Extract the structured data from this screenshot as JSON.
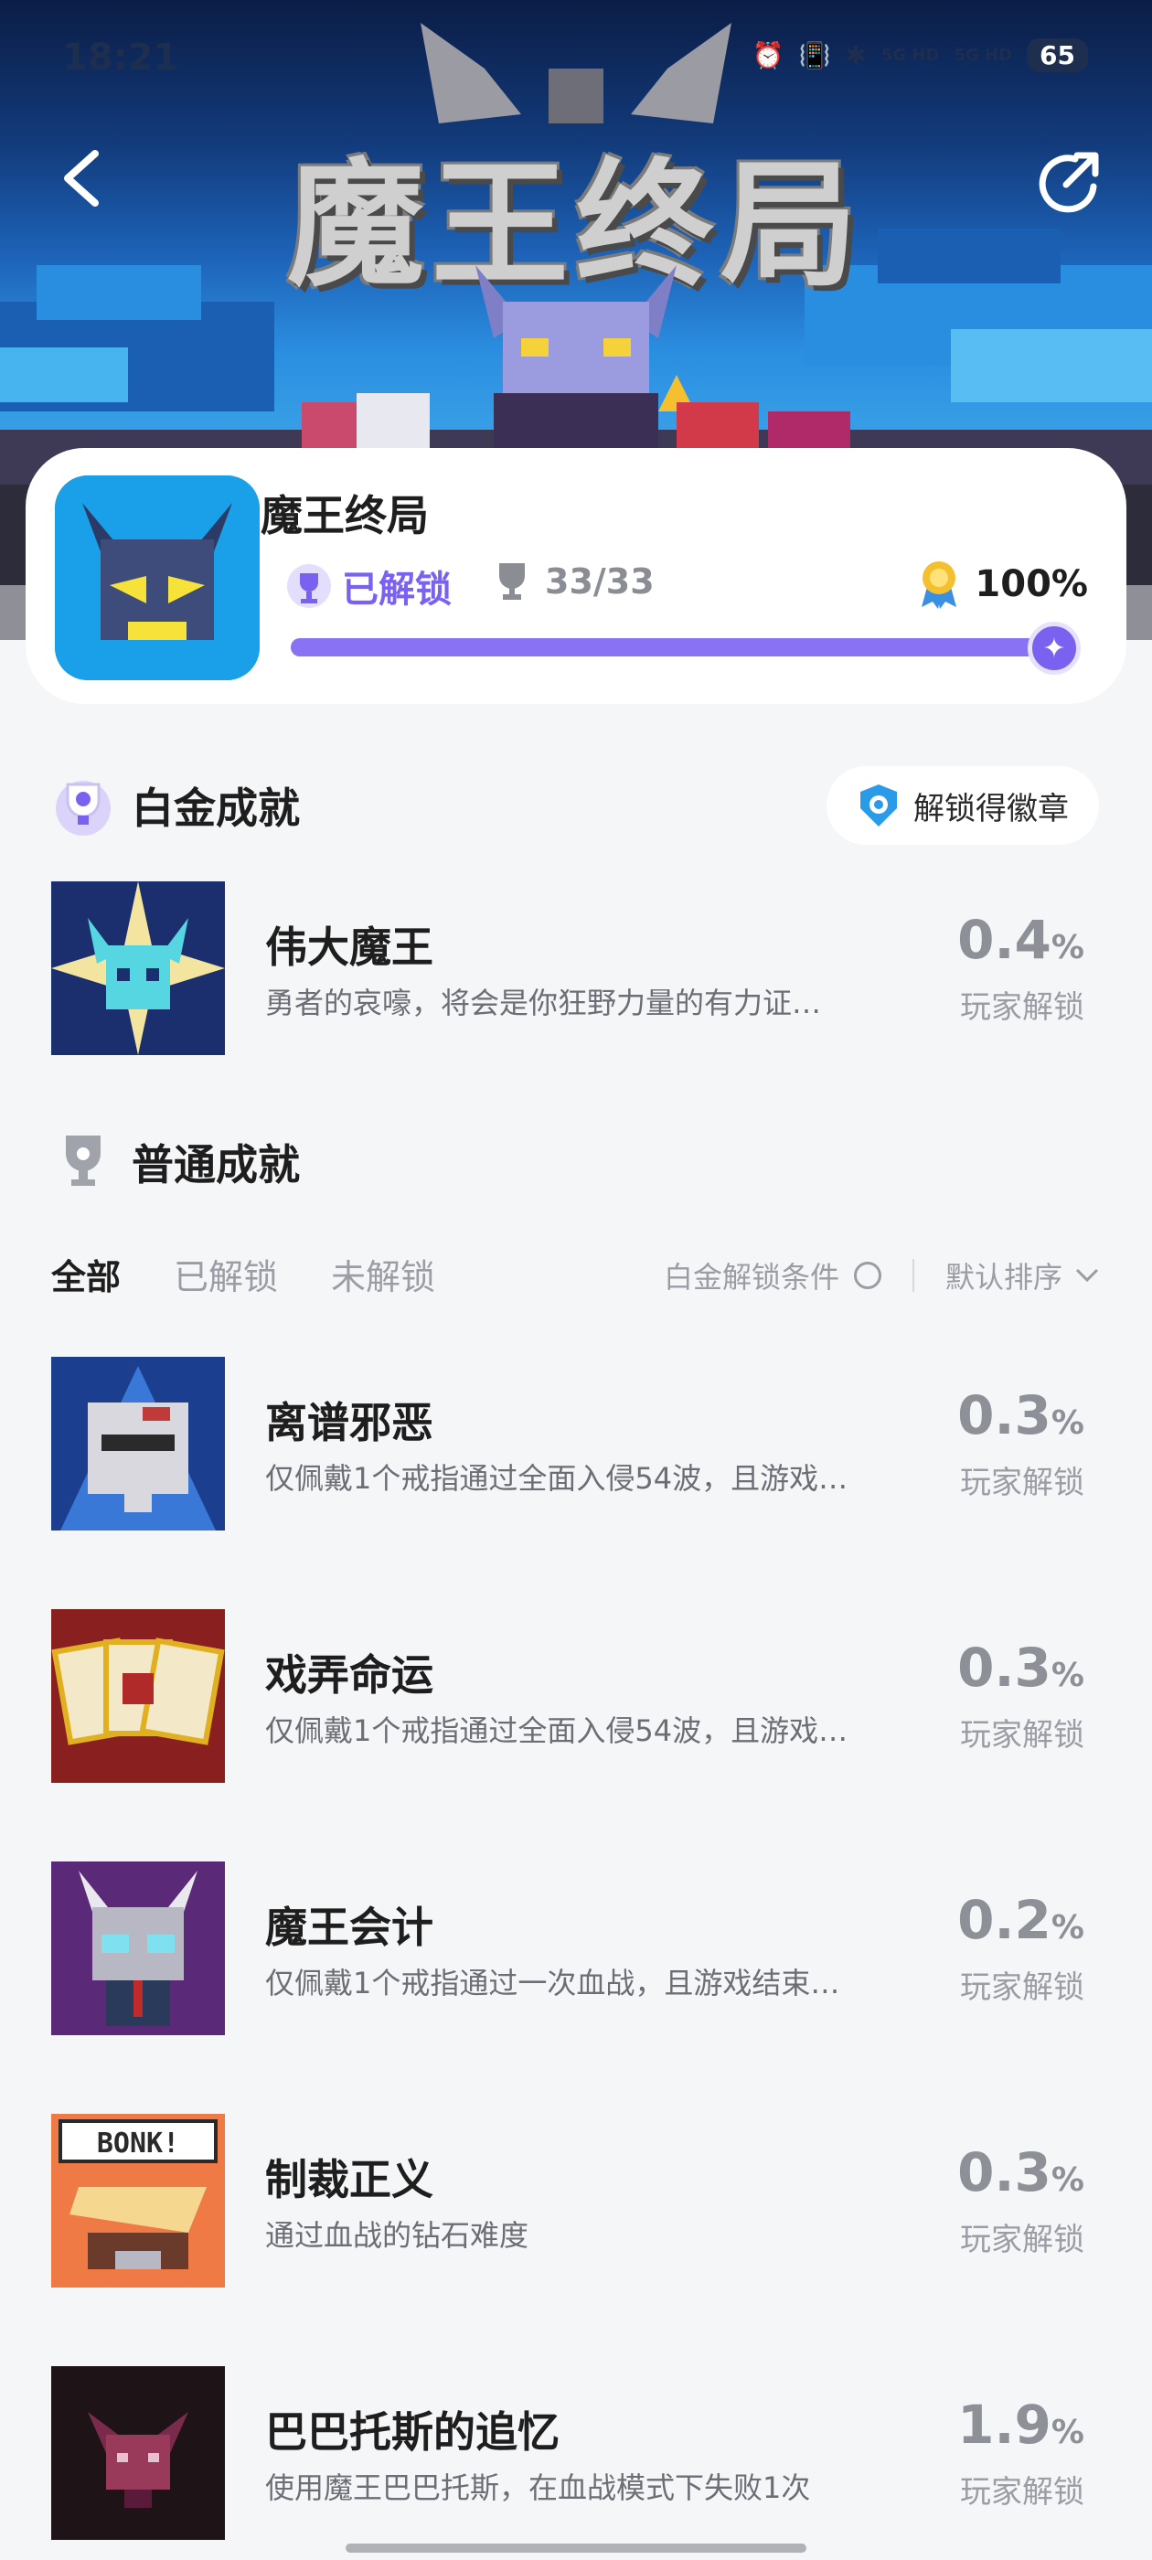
{
  "status_bar": {
    "time": "18:21",
    "signal1": "5G HD",
    "signal2": "5G HD",
    "battery": "65"
  },
  "hero": {
    "title": "魔王终局"
  },
  "game": {
    "name": "魔王终局",
    "status": "已解锁",
    "count": "33/33",
    "percent": "100%",
    "progress": 1.0
  },
  "platinum": {
    "section_title": "白金成就",
    "badge_button": "解锁得徽章",
    "item": {
      "title": "伟大魔王",
      "desc": "勇者的哀嚎，将会是你狂野力量的有力证…",
      "rate": "0.4",
      "rate_unit": "%",
      "sub": "玩家解锁"
    }
  },
  "normal": {
    "section_title": "普通成就",
    "filters": [
      "全部",
      "已解锁",
      "未解锁"
    ],
    "condition_label": "白金解锁条件",
    "sort_label": "默认排序",
    "items": [
      {
        "title": "离谱邪恶",
        "desc": "仅佩戴1个戒指通过全面入侵54波，且游戏…",
        "rate": "0.3",
        "rate_unit": "%",
        "sub": "玩家解锁"
      },
      {
        "title": "戏弄命运",
        "desc": "仅佩戴1个戒指通过全面入侵54波，且游戏…",
        "rate": "0.3",
        "rate_unit": "%",
        "sub": "玩家解锁"
      },
      {
        "title": "魔王会计",
        "desc": "仅佩戴1个戒指通过一次血战，且游戏结束…",
        "rate": "0.2",
        "rate_unit": "%",
        "sub": "玩家解锁"
      },
      {
        "title": "制裁正义",
        "desc": "通过血战的钻石难度",
        "rate": "0.3",
        "rate_unit": "%",
        "sub": "玩家解锁",
        "img_text": "BONK!"
      },
      {
        "title": "巴巴托斯的追忆",
        "desc": "使用魔王巴巴托斯，在血战模式下失败1次",
        "rate": "1.9",
        "rate_unit": "%",
        "sub": "玩家解锁"
      }
    ]
  },
  "colors": {
    "accent": "#7b61f0",
    "background": "#f5f6f8",
    "gray_text": "#9a9da4"
  },
  "icons": [
    "back-arrow",
    "share",
    "trophy",
    "medal",
    "shield-badge"
  ]
}
